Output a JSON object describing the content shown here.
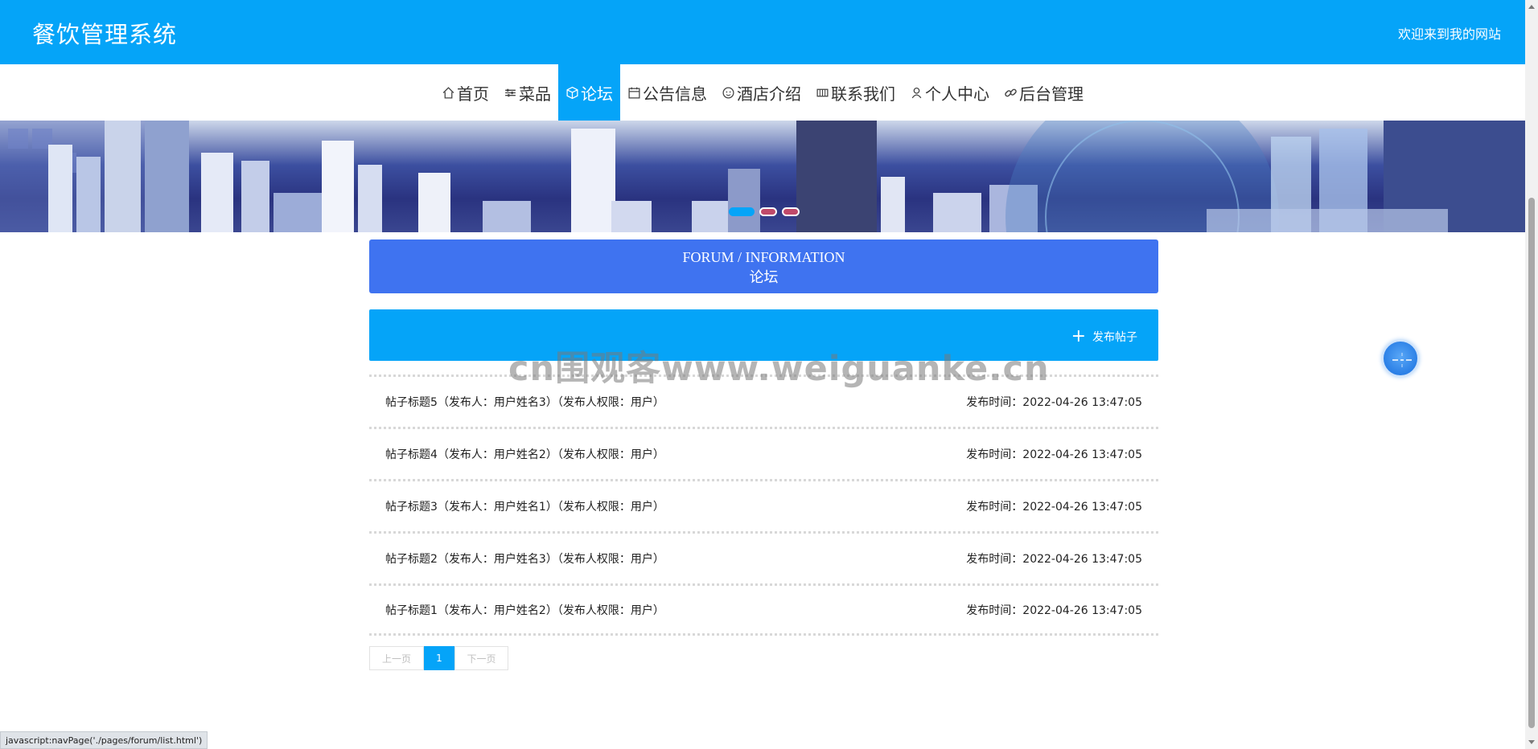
{
  "header": {
    "site_title": "餐饮管理系统",
    "welcome_text": "欢迎来到我的网站"
  },
  "nav": {
    "items": [
      {
        "label": "首页",
        "icon": "home-icon"
      },
      {
        "label": "菜品",
        "icon": "sliders-icon"
      },
      {
        "label": "论坛",
        "icon": "cube-icon"
      },
      {
        "label": "公告信息",
        "icon": "calendar-icon"
      },
      {
        "label": "酒店介绍",
        "icon": "smile-icon"
      },
      {
        "label": "联系我们",
        "icon": "grid-icon"
      },
      {
        "label": "个人中心",
        "icon": "user-icon"
      },
      {
        "label": "后台管理",
        "icon": "link-icon"
      }
    ],
    "active_label": "论坛"
  },
  "banner": {
    "slide_count": 3,
    "active_slide": 1
  },
  "section": {
    "title_en": "FORUM / INFORMATION",
    "title_cn": "论坛"
  },
  "actions": {
    "post_label": "发布帖子"
  },
  "posts": [
    {
      "title": "帖子标题5（发布人：用户姓名3）（发布人权限：用户）",
      "time": "发布时间：2022-04-26 13:47:05"
    },
    {
      "title": "帖子标题4（发布人：用户姓名2）（发布人权限：用户）",
      "time": "发布时间：2022-04-26 13:47:05"
    },
    {
      "title": "帖子标题3（发布人：用户姓名1）（发布人权限：用户）",
      "time": "发布时间：2022-04-26 13:47:05"
    },
    {
      "title": "帖子标题2（发布人：用户姓名3）（发布人权限：用户）",
      "time": "发布时间：2022-04-26 13:47:05"
    },
    {
      "title": "帖子标题1（发布人：用户姓名2）（发布人权限：用户）",
      "time": "发布时间：2022-04-26 13:47:05"
    }
  ],
  "pagination": {
    "prev_label": "上一页",
    "current_page": "1",
    "next_label": "下一页"
  },
  "watermark": "cn围观客www.weiguanke.cn",
  "status_bar": "javascript:navPage('./pages/forum/list.html')",
  "colors": {
    "primary": "#05a4f8",
    "section_head": "#3f73f0"
  }
}
